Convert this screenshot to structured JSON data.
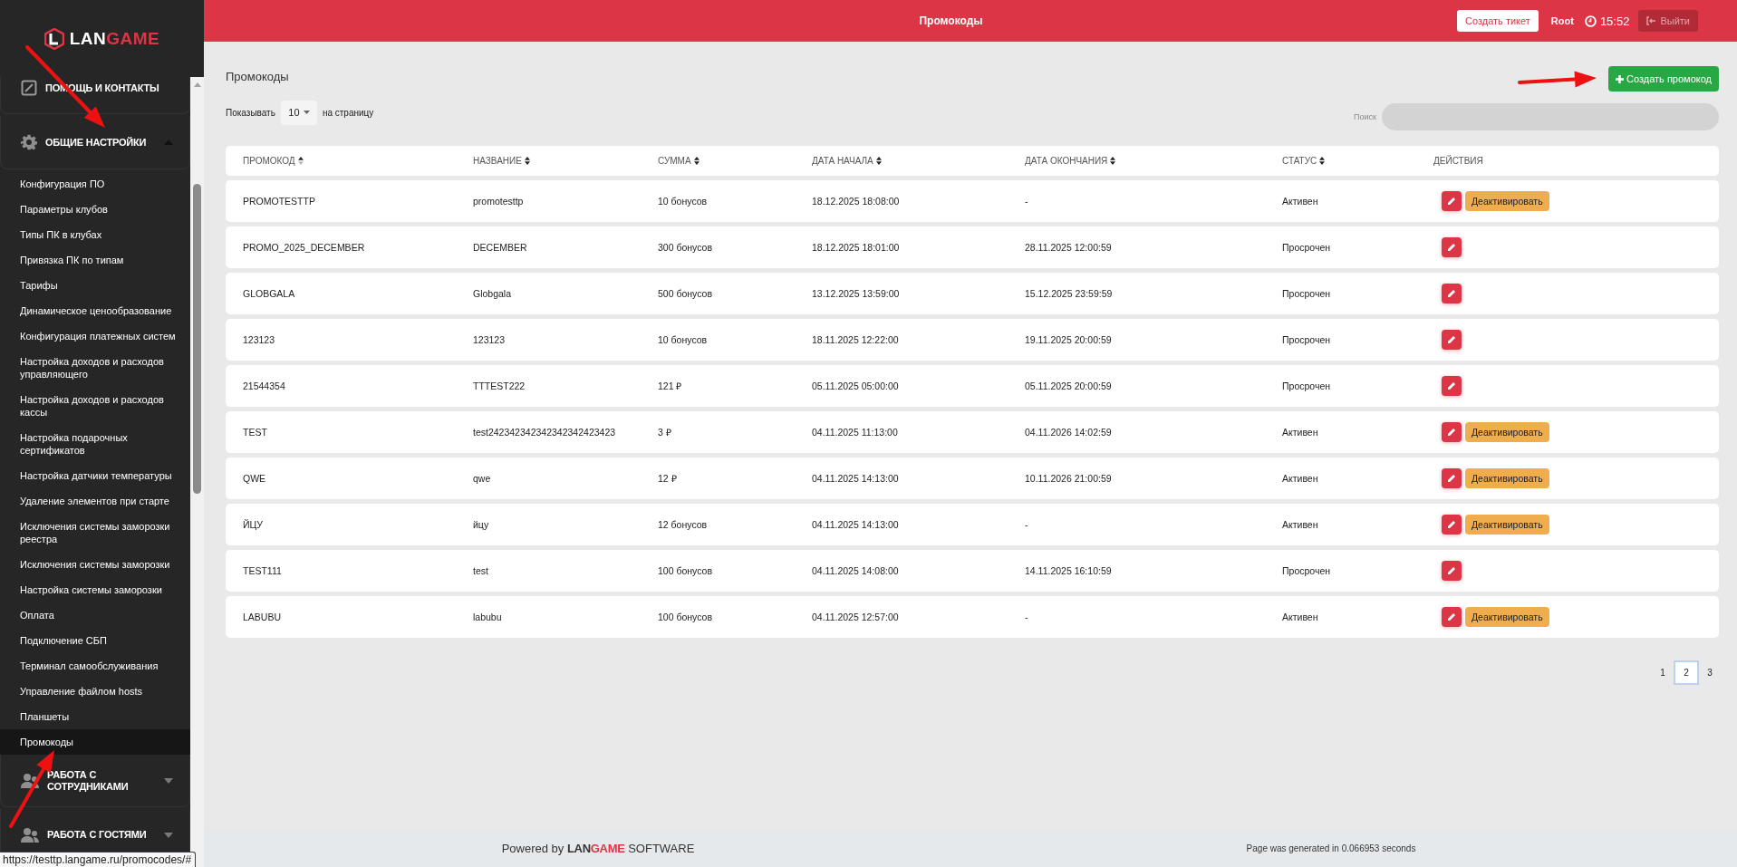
{
  "sidebar": {
    "logo": {
      "light": "LAN",
      "accent": "GAME"
    },
    "sections": [
      {
        "kind": "edit",
        "label": "ПОМОЩЬ И КОНТАКТЫ"
      },
      {
        "kind": "gear",
        "label": "ОБЩИЕ НАСТРОЙКИ",
        "expanded": true,
        "items": [
          {
            "label": "Конфигурация ПО",
            "selected": false
          },
          {
            "label": "Параметры клубов",
            "selected": false
          },
          {
            "label": "Типы ПК в клубах",
            "selected": false
          },
          {
            "label": "Привязка ПК по типам",
            "selected": false
          },
          {
            "label": "Тарифы",
            "selected": false
          },
          {
            "label": "Динамическое ценообразование",
            "selected": false
          },
          {
            "label": "Конфигурация платежных систем",
            "selected": false
          },
          {
            "label": "Настройка доходов и расходов управляющего",
            "selected": false
          },
          {
            "label": "Настройка доходов и расходов кассы",
            "selected": false
          },
          {
            "label": "Настройка подарочных сертификатов",
            "selected": false
          },
          {
            "label": "Настройка датчики температуры",
            "selected": false
          },
          {
            "label": "Удаление элементов при старте",
            "selected": false
          },
          {
            "label": "Исключения системы заморозки реестра",
            "selected": false
          },
          {
            "label": "Исключения системы заморозки",
            "selected": false
          },
          {
            "label": "Настройка системы заморозки",
            "selected": false
          },
          {
            "label": "Оплата",
            "selected": false
          },
          {
            "label": "Подключение СБП",
            "selected": false
          },
          {
            "label": "Терминал самообслуживания",
            "selected": false
          },
          {
            "label": "Управление файлом hosts",
            "selected": false
          },
          {
            "label": "Планшеты",
            "selected": false
          },
          {
            "label": "Промокоды",
            "selected": true
          }
        ]
      },
      {
        "kind": "users",
        "label": "РАБОТА С СОТРУДНИКАМИ",
        "expanded": false
      },
      {
        "kind": "users",
        "label": "РАБОТА С ГОСТЯМИ",
        "expanded": false
      }
    ]
  },
  "header": {
    "title": "Промокоды",
    "ticket_button": "Создать тикет",
    "user": "Root",
    "time": "15:52",
    "logout_button": "Выйти"
  },
  "page": {
    "title": "Промокоды",
    "create_button": "Создать промокод",
    "page_size": {
      "label_before": "Показывать",
      "value": "10",
      "label_after": "на страницу"
    },
    "search": {
      "label": "Поиск"
    }
  },
  "table": {
    "columns": [
      {
        "label": "ПРОМОКОД",
        "sorted": true
      },
      {
        "label": "НАЗВАНИЕ",
        "sorted": false
      },
      {
        "label": "СУММА",
        "sorted": false
      },
      {
        "label": "ДАТА НАЧАЛА",
        "sorted": false
      },
      {
        "label": "ДАТА ОКОНЧАНИЯ",
        "sorted": false
      },
      {
        "label": "СТАТУС",
        "sorted": false
      },
      {
        "label": "ДЕЙСТВИЯ"
      }
    ],
    "rows": [
      {
        "cells": [
          "PROMOTESTTP",
          "promotesttp",
          "10 бонусов",
          "18.12.2025 18:08:00",
          "-",
          "Активен"
        ],
        "actions": [
          {
            "kind": "edit"
          },
          {
            "kind": "deactivate",
            "label": "Деактивировать"
          }
        ]
      },
      {
        "cells": [
          "PROMO_2025_DECEMBER",
          "DECEMBER",
          "300 бонусов",
          "18.12.2025 18:01:00",
          "28.11.2025 12:00:59",
          "Просрочен"
        ],
        "actions": [
          {
            "kind": "edit"
          }
        ]
      },
      {
        "cells": [
          "GLOBGALA",
          "Globgala",
          "500 бонусов",
          "13.12.2025 13:59:00",
          "15.12.2025 23:59:59",
          "Просрочен"
        ],
        "actions": [
          {
            "kind": "edit"
          }
        ]
      },
      {
        "cells": [
          "123123",
          "123123",
          "10 бонусов",
          "18.11.2025 12:22:00",
          "19.11.2025 20:00:59",
          "Просрочен"
        ],
        "actions": [
          {
            "kind": "edit"
          }
        ]
      },
      {
        "cells": [
          "21544354",
          "TTTEST222",
          "121 ₽",
          "05.11.2025 05:00:00",
          "05.11.2025 20:00:59",
          "Просрочен"
        ],
        "actions": [
          {
            "kind": "edit"
          }
        ]
      },
      {
        "cells": [
          "TEST",
          "test242342342342342342423423",
          "3 ₽",
          "04.11.2025 11:13:00",
          "04.11.2026 14:02:59",
          "Активен"
        ],
        "actions": [
          {
            "kind": "edit"
          },
          {
            "kind": "deactivate",
            "label": "Деактивировать"
          }
        ]
      },
      {
        "cells": [
          "QWE",
          "qwe",
          "12 ₽",
          "04.11.2025 14:13:00",
          "10.11.2026 21:00:59",
          "Активен"
        ],
        "actions": [
          {
            "kind": "edit"
          },
          {
            "kind": "deactivate",
            "label": "Деактивировать"
          }
        ]
      },
      {
        "cells": [
          "ЙЦУ",
          "йцу",
          "12 бонусов",
          "04.11.2025 14:13:00",
          "-",
          "Активен"
        ],
        "actions": [
          {
            "kind": "edit"
          },
          {
            "kind": "deactivate",
            "label": "Деактивировать"
          }
        ]
      },
      {
        "cells": [
          "TEST111",
          "test",
          "100 бонусов",
          "04.11.2025 14:08:00",
          "14.11.2025 16:10:59",
          "Просрочен"
        ],
        "actions": [
          {
            "kind": "edit"
          }
        ]
      },
      {
        "cells": [
          "LABUBU",
          "labubu",
          "100 бонусов",
          "04.11.2025 12:57:00",
          "-",
          "Активен"
        ],
        "actions": [
          {
            "kind": "edit"
          },
          {
            "kind": "deactivate",
            "label": "Деактивировать"
          }
        ]
      }
    ]
  },
  "pagination": [
    {
      "label": "1",
      "selected": false
    },
    {
      "label": "2",
      "selected": true
    },
    {
      "label": "3",
      "selected": false
    }
  ],
  "footer": {
    "powered_by": "Powered by",
    "logo": {
      "dark": "LAN",
      "accent": "GAME"
    },
    "suffix": "SOFTWARE",
    "generated": "Page was generated in 0.066953 seconds"
  },
  "status_url": "https://testtp.langame.ru/promocodes/#"
}
